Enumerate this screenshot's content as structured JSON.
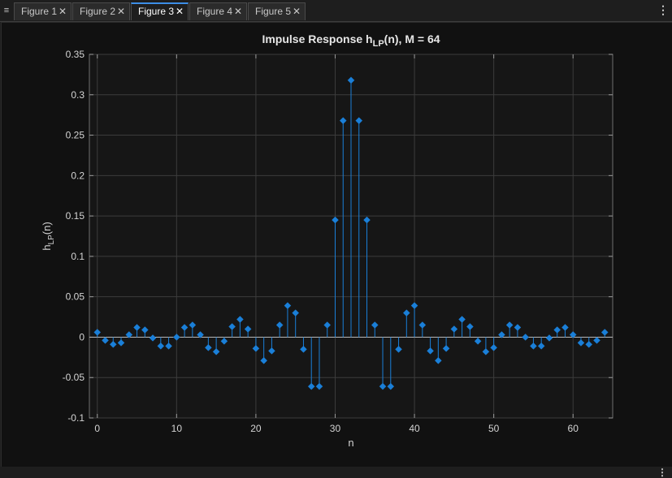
{
  "tabs": [
    {
      "label": "Figure 1",
      "active": false
    },
    {
      "label": "Figure 2",
      "active": false
    },
    {
      "label": "Figure 3",
      "active": true
    },
    {
      "label": "Figure 4",
      "active": false
    },
    {
      "label": "Figure 5",
      "active": false
    }
  ],
  "icons": {
    "tab_menu": "panel-menu-icon",
    "close": "close-icon",
    "more": "more-options-icon"
  },
  "colors": {
    "stem": "#1a7fd8",
    "background": "#111111",
    "axes": "#161616",
    "grid": "#3c3c3c",
    "text": "#d4d4d4"
  },
  "chart_data": {
    "type": "stem",
    "title": "Impulse Response h_LP(n), M = 64",
    "title_parts": {
      "prefix": "Impulse Response h",
      "subscript": "LP",
      "suffix": "(n), M = 64"
    },
    "xlabel": "n",
    "ylabel": "h_LP(n)",
    "ylabel_parts": {
      "prefix": "h",
      "subscript": "LP",
      "suffix": "(n)"
    },
    "xlim": [
      -1,
      65
    ],
    "ylim": [
      -0.1,
      0.35
    ],
    "xticks": [
      0,
      10,
      20,
      30,
      40,
      50,
      60
    ],
    "xtick_labels": [
      "0",
      "10",
      "20",
      "30",
      "40",
      "50",
      "60"
    ],
    "yticks": [
      -0.1,
      -0.05,
      0,
      0.05,
      0.1,
      0.15,
      0.2,
      0.25,
      0.3,
      0.35
    ],
    "ytick_labels": [
      "-0.1",
      "-0.05",
      "0",
      "0.05",
      "0.1",
      "0.15",
      "0.2",
      "0.25",
      "0.3",
      "0.35"
    ],
    "grid": true,
    "marker": "diamond",
    "x": [
      0,
      1,
      2,
      3,
      4,
      5,
      6,
      7,
      8,
      9,
      10,
      11,
      12,
      13,
      14,
      15,
      16,
      17,
      18,
      19,
      20,
      21,
      22,
      23,
      24,
      25,
      26,
      27,
      28,
      29,
      30,
      31,
      32,
      33,
      34,
      35,
      36,
      37,
      38,
      39,
      40,
      41,
      42,
      43,
      44,
      45,
      46,
      47,
      48,
      49,
      50,
      51,
      52,
      53,
      54,
      55,
      56,
      57,
      58,
      59,
      60,
      61,
      62,
      63,
      64
    ],
    "y": [
      0.006,
      -0.004,
      -0.009,
      -0.007,
      0.003,
      0.012,
      0.009,
      -0.001,
      -0.011,
      -0.011,
      0.0,
      0.012,
      0.015,
      0.003,
      -0.013,
      -0.018,
      -0.005,
      0.013,
      0.022,
      0.01,
      -0.014,
      -0.029,
      -0.017,
      0.015,
      0.039,
      0.03,
      -0.015,
      -0.061,
      -0.061,
      0.015,
      0.145,
      0.268,
      0.318,
      0.268,
      0.145,
      0.015,
      -0.061,
      -0.061,
      -0.015,
      0.03,
      0.039,
      0.015,
      -0.017,
      -0.029,
      -0.014,
      0.01,
      0.022,
      0.013,
      -0.005,
      -0.018,
      -0.013,
      0.003,
      0.015,
      0.012,
      0.0,
      -0.011,
      -0.011,
      -0.001,
      0.009,
      0.012,
      0.003,
      -0.007,
      -0.009,
      -0.004,
      0.006
    ]
  }
}
